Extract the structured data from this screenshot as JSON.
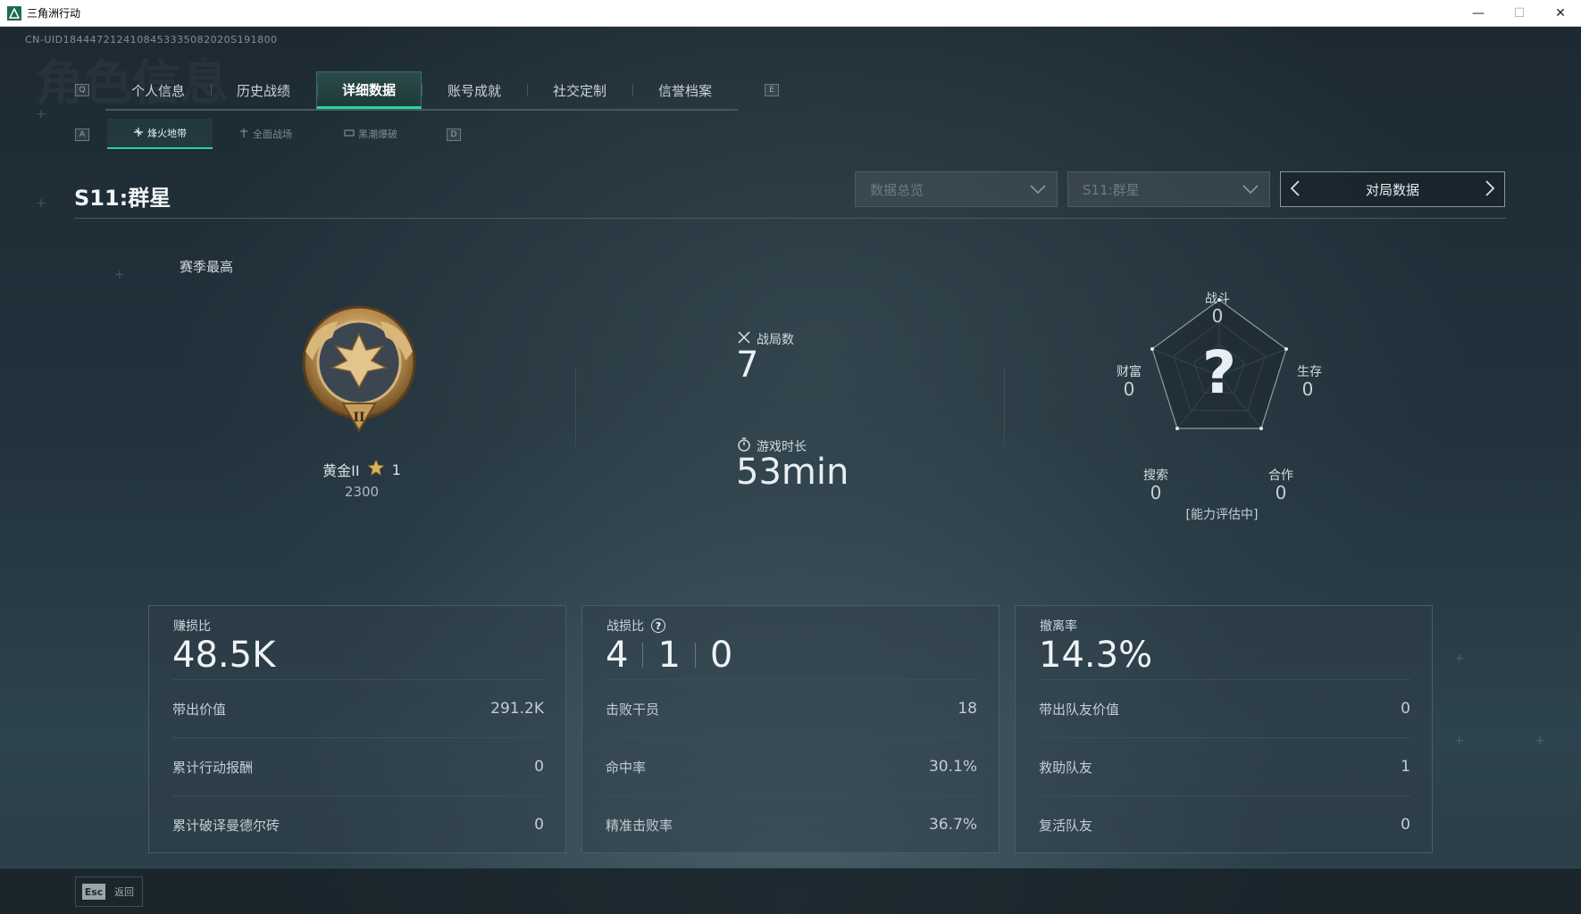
{
  "window": {
    "title": "三角洲行动",
    "minimize": "—",
    "maximize": "☐",
    "close": "✕"
  },
  "uid": "CN-UID1844472124108453335082020S191800",
  "ghost_title": "角色信息",
  "main_tabs": {
    "left_key": "Q",
    "right_key": "E",
    "items": [
      {
        "label": "个人信息"
      },
      {
        "label": "历史战绩"
      },
      {
        "label": "详细数据",
        "active": true
      },
      {
        "label": "账号成就"
      },
      {
        "label": "社交定制"
      },
      {
        "label": "信誉档案"
      }
    ]
  },
  "sub_tabs": {
    "left_key": "A",
    "right_key": "D",
    "items": [
      {
        "label": "烽火地带",
        "icon": "beacon-icon",
        "active": true
      },
      {
        "label": "全面战场",
        "icon": "battlefield-icon"
      },
      {
        "label": "黑潮爆破",
        "icon": "demolition-icon"
      }
    ]
  },
  "season_title": "S11:群星",
  "filters": {
    "data_overview": "数据总览",
    "season": "S11:群星",
    "match_data": "对局数据"
  },
  "rank": {
    "section_label": "赛季最高",
    "tier": "黄金II",
    "stars": "1",
    "score": "2300"
  },
  "stats": {
    "matches_label": "战局数",
    "matches_value": "7",
    "playtime_label": "游戏时长",
    "playtime_value": "53min"
  },
  "radar": {
    "center_mark": "?",
    "status": "[能力评估中]",
    "axes": [
      {
        "label": "战斗",
        "value": "0"
      },
      {
        "label": "生存",
        "value": "0"
      },
      {
        "label": "合作",
        "value": "0"
      },
      {
        "label": "搜索",
        "value": "0"
      },
      {
        "label": "财富",
        "value": "0"
      }
    ]
  },
  "cards": [
    {
      "label": "赚损比",
      "value": "48.5K",
      "rows": [
        {
          "label": "带出价值",
          "value": "291.2K"
        },
        {
          "label": "累计行动报酬",
          "value": "0"
        },
        {
          "label": "累计破译曼德尔砖",
          "value": "0"
        }
      ]
    },
    {
      "label": "战损比",
      "help": "?",
      "kda": [
        "4",
        "1",
        "0"
      ],
      "rows": [
        {
          "label": "击败干员",
          "value": "18"
        },
        {
          "label": "命中率",
          "value": "30.1%"
        },
        {
          "label": "精准击败率",
          "value": "36.7%"
        }
      ]
    },
    {
      "label": "撤离率",
      "value": "14.3%",
      "rows": [
        {
          "label": "带出队友价值",
          "value": "0"
        },
        {
          "label": "救助队友",
          "value": "1"
        },
        {
          "label": "复活队友",
          "value": "0"
        }
      ]
    }
  ],
  "footer": {
    "esc_key": "Esc",
    "back_label": "返回"
  },
  "colors": {
    "accent": "#27d6a0",
    "background": "#1b2933",
    "gold": "#c9a25a"
  }
}
